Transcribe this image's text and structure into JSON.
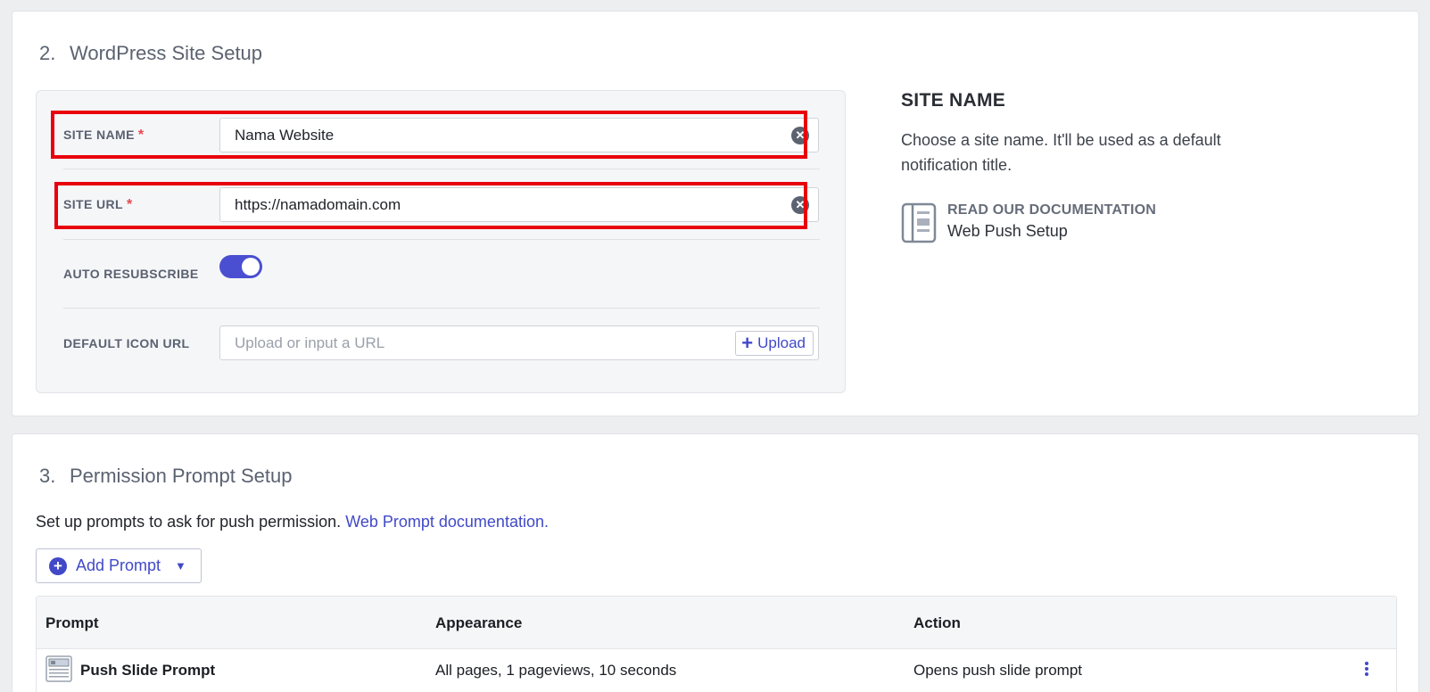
{
  "site_setup": {
    "number": "2.",
    "title": "WordPress Site Setup",
    "site_name": {
      "label": "SITE NAME",
      "required_mark": "*",
      "value": "Nama Website",
      "clear_glyph": "✕"
    },
    "site_url": {
      "label": "SITE URL",
      "required_mark": "*",
      "value": "https://namadomain.com",
      "clear_glyph": "✕"
    },
    "auto_resubscribe": {
      "label": "AUTO RESUBSCRIBE",
      "enabled": true
    },
    "default_icon_url": {
      "label": "DEFAULT ICON URL",
      "placeholder": "Upload or input a URL",
      "upload_label": "Upload",
      "upload_glyph": "+"
    },
    "help": {
      "title": "SITE NAME",
      "text": "Choose a site name. It'll be used as a default notification title.",
      "doc_kicker": "READ OUR DOCUMENTATION",
      "doc_name": "Web Push Setup",
      "doc_icon": "document-icon"
    }
  },
  "permission_prompt": {
    "number": "3.",
    "title": "Permission Prompt Setup",
    "intro": "Set up prompts to ask for push permission.",
    "doc_link": "Web Prompt documentation.",
    "add_button": {
      "label": "Add Prompt",
      "icon": "plus-circle-icon",
      "icon_glyph": "+",
      "caret": "▼"
    },
    "table": {
      "headers": {
        "prompt": "Prompt",
        "appearance": "Appearance",
        "action": "Action"
      },
      "rows": [
        {
          "prompt": "Push Slide Prompt",
          "appearance": "All pages, 1 pageviews, 10 seconds",
          "action": "Opens push slide prompt",
          "icon": "slide-prompt-icon"
        }
      ]
    }
  },
  "colors": {
    "accent": "#4149c8",
    "toggle_on": "#4a4fd1",
    "highlight": "#e8000c",
    "required": "#e5484d"
  }
}
